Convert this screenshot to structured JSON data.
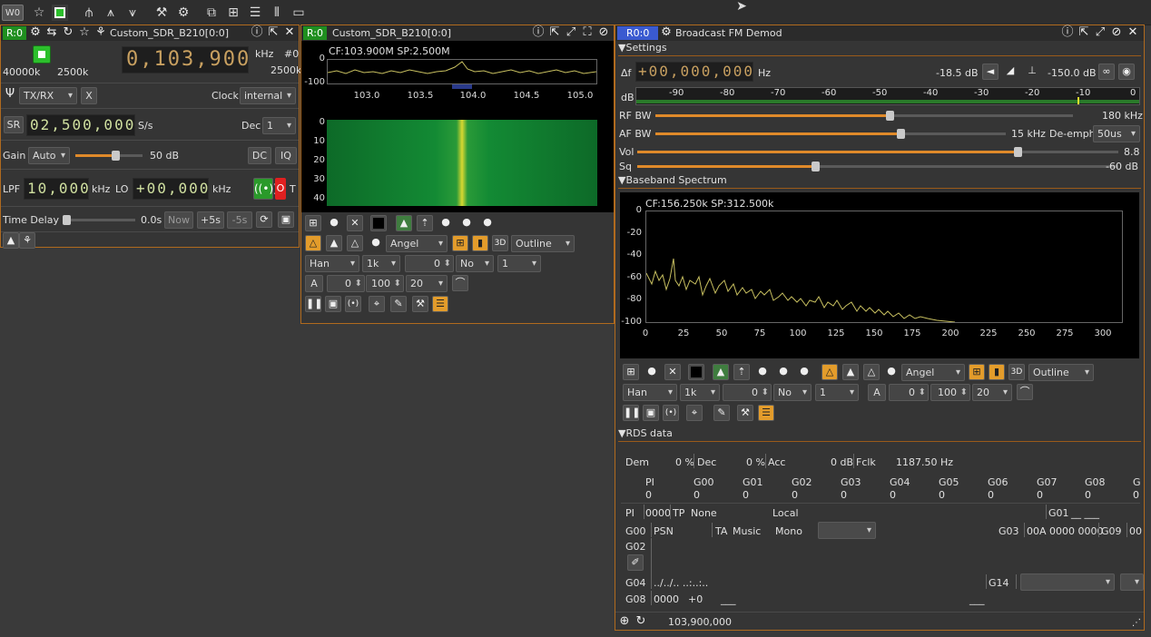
{
  "toolbar": {
    "workspace_tag": "W0"
  },
  "rx_panel": {
    "tag": "R:0",
    "device_name": "Custom_SDR_B210[0:0]",
    "freq_unit": "kHz",
    "freq_value": "0,103,900",
    "device_index": "#0",
    "left_rate": "40000k",
    "mid_rate": "2500k",
    "right_rate": "2500k",
    "antenna": "TX/RX",
    "x_btn": "X",
    "clock_label": "Clock",
    "clock_value": "internal",
    "sr_label": "SR",
    "sr_value": "02,500,000",
    "sr_unit": "S/s",
    "dec_label": "Dec",
    "dec_value": "1",
    "gain_label": "Gain",
    "gain_mode": "Auto",
    "gain_value": "50 dB",
    "gain_level": 0.6,
    "dc_btn": "DC",
    "iq_btn": "IQ",
    "lpf_label": "LPF",
    "lpf_value": "10,000",
    "lpf_unit": "kHz",
    "lo_label": "LO",
    "lo_value": "+00,000",
    "lo_unit": "kHz",
    "o_label": "O",
    "t_label": "T",
    "time_delay_label": "Time Delay",
    "time_delay_value": "0.0s",
    "now_btn": "Now",
    "plus5_btn": "+5s",
    "minus5_btn": "-5s"
  },
  "spectrum_panel": {
    "tag": "R:0",
    "title": "Custom_SDR_B210[0:0]",
    "cf_sp": "CF:103.900M SP:2.500M",
    "y_ticks": [
      "0",
      "-100"
    ],
    "x_ticks": [
      "103.0",
      "103.5",
      "104.0",
      "104.5",
      "105.0"
    ],
    "wf_ticks": [
      "0",
      "10",
      "20",
      "30",
      "40"
    ],
    "palette": "Angel",
    "outline": "Outline",
    "window": "Han",
    "fft": "1k",
    "zero_val": "0",
    "no_opt": "No",
    "one_opt": "1",
    "a_btn": "A",
    "ref_val": "0",
    "range_val": "100",
    "avg_val": "20"
  },
  "demod_panel": {
    "tag": "R0:0",
    "title": "Broadcast FM Demod",
    "settings_label": "Settings",
    "df_label": "Δf",
    "df_value": "+00,000,000",
    "df_unit": "Hz",
    "db_level": "-18.5  dB",
    "squelch_level": "-150.0 dB",
    "db_label": "dB",
    "db_scale": [
      "-90",
      "-80",
      "-70",
      "-60",
      "-50",
      "-40",
      "-30",
      "-20",
      "-10",
      "0"
    ],
    "rfbw_label": "RF BW",
    "rfbw_value": "180 kHz",
    "rfbw_level": 0.56,
    "afbw_label": "AF BW",
    "afbw_value": "15 kHz",
    "afbw_level": 0.7,
    "deemph_label": "De-emph",
    "deemph_value": "50us",
    "vol_label": "Vol",
    "vol_value": "8.8",
    "vol_level": 0.79,
    "sq_label": "Sq",
    "sq_value": "-60 dB",
    "sq_level": 0.37,
    "baseband_label": "Baseband Spectrum",
    "bb_cf_sp": "CF:156.250k SP:312.500k",
    "bb_y_ticks": [
      "0",
      "-20",
      "-40",
      "-60",
      "-80",
      "-100"
    ],
    "bb_x_ticks": [
      "0",
      "25",
      "50",
      "75",
      "100",
      "125",
      "150",
      "175",
      "200",
      "225",
      "250",
      "275",
      "300"
    ],
    "palette": "Angel",
    "outline": "Outline",
    "window": "Han",
    "fft": "1k",
    "zero_val": "0",
    "no_opt": "No",
    "one_opt": "1",
    "a_btn": "A",
    "ref_val": "0",
    "range_val": "100",
    "avg_val": "20",
    "rds_label": "RDS data",
    "dem_label": "Dem",
    "dem_value": "0 %",
    "dec_label": "Dec",
    "dec_value": "0 %",
    "acc_label": "Acc",
    "acc_value": "0 dB",
    "fclk_label": "Fclk",
    "fclk_value": "1187.50 Hz",
    "group_headers": [
      "PI",
      "G00",
      "G01",
      "G02",
      "G03",
      "G04",
      "G05",
      "G06",
      "G07",
      "G08",
      "G"
    ],
    "group_values": [
      "0",
      "0",
      "0",
      "0",
      "0",
      "0",
      "0",
      "0",
      "0",
      "0",
      "0"
    ],
    "pi_label": "PI",
    "pi_value": "0000",
    "tp_label": "TP",
    "tp_value": "None",
    "local_label": "Local",
    "g01_label": "G01",
    "g01_value": "__ ___",
    "g00_label": "G00",
    "psn_value": "PSN",
    "ta_label": "TA",
    "music_label": "Music",
    "mono_label": "Mono",
    "g03_label": "G03",
    "g03_value": "00A 0000 0000",
    "g09_label": "G09",
    "g09_value": "00",
    "g02_label": "G02",
    "g04_label": "G04",
    "g04_value": "../../.. ..:..:..",
    "g14_label": "G14",
    "g08_label": "G08",
    "g08_value": "0000",
    "g08_offset": "+0",
    "g08_blank1": "___",
    "g08_blank2": "___",
    "status_freq": "103,900,000"
  }
}
